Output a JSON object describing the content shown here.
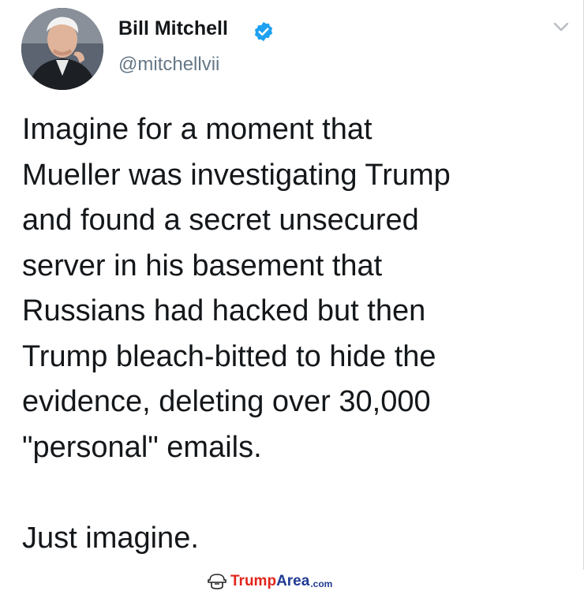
{
  "tweet": {
    "author_name": "Bill Mitchell",
    "author_handle": "@mitchellvii",
    "body_lines": [
      "Imagine for a moment that",
      "Mueller was investigating Trump",
      "and found a secret unsecured",
      "server in his basement that",
      "Russians had hacked but then",
      "Trump bleach-bitted to hide the",
      "evidence, deleting over 30,000",
      "\"personal\" emails."
    ],
    "closing_line": "Just imagine."
  },
  "watermark": {
    "part1": "Trump",
    "part2": "Area",
    "part3": ".com"
  },
  "icons": {
    "verified": "verified-badge-icon",
    "menu": "chevron-down-icon",
    "watermark_logo": "trumparea-logo-icon"
  },
  "colors": {
    "verified_blue": "#1da1f2",
    "handle_gray": "#657786",
    "text": "#14171a",
    "watermark_red": "#e1251b",
    "watermark_blue": "#1f3a93"
  }
}
